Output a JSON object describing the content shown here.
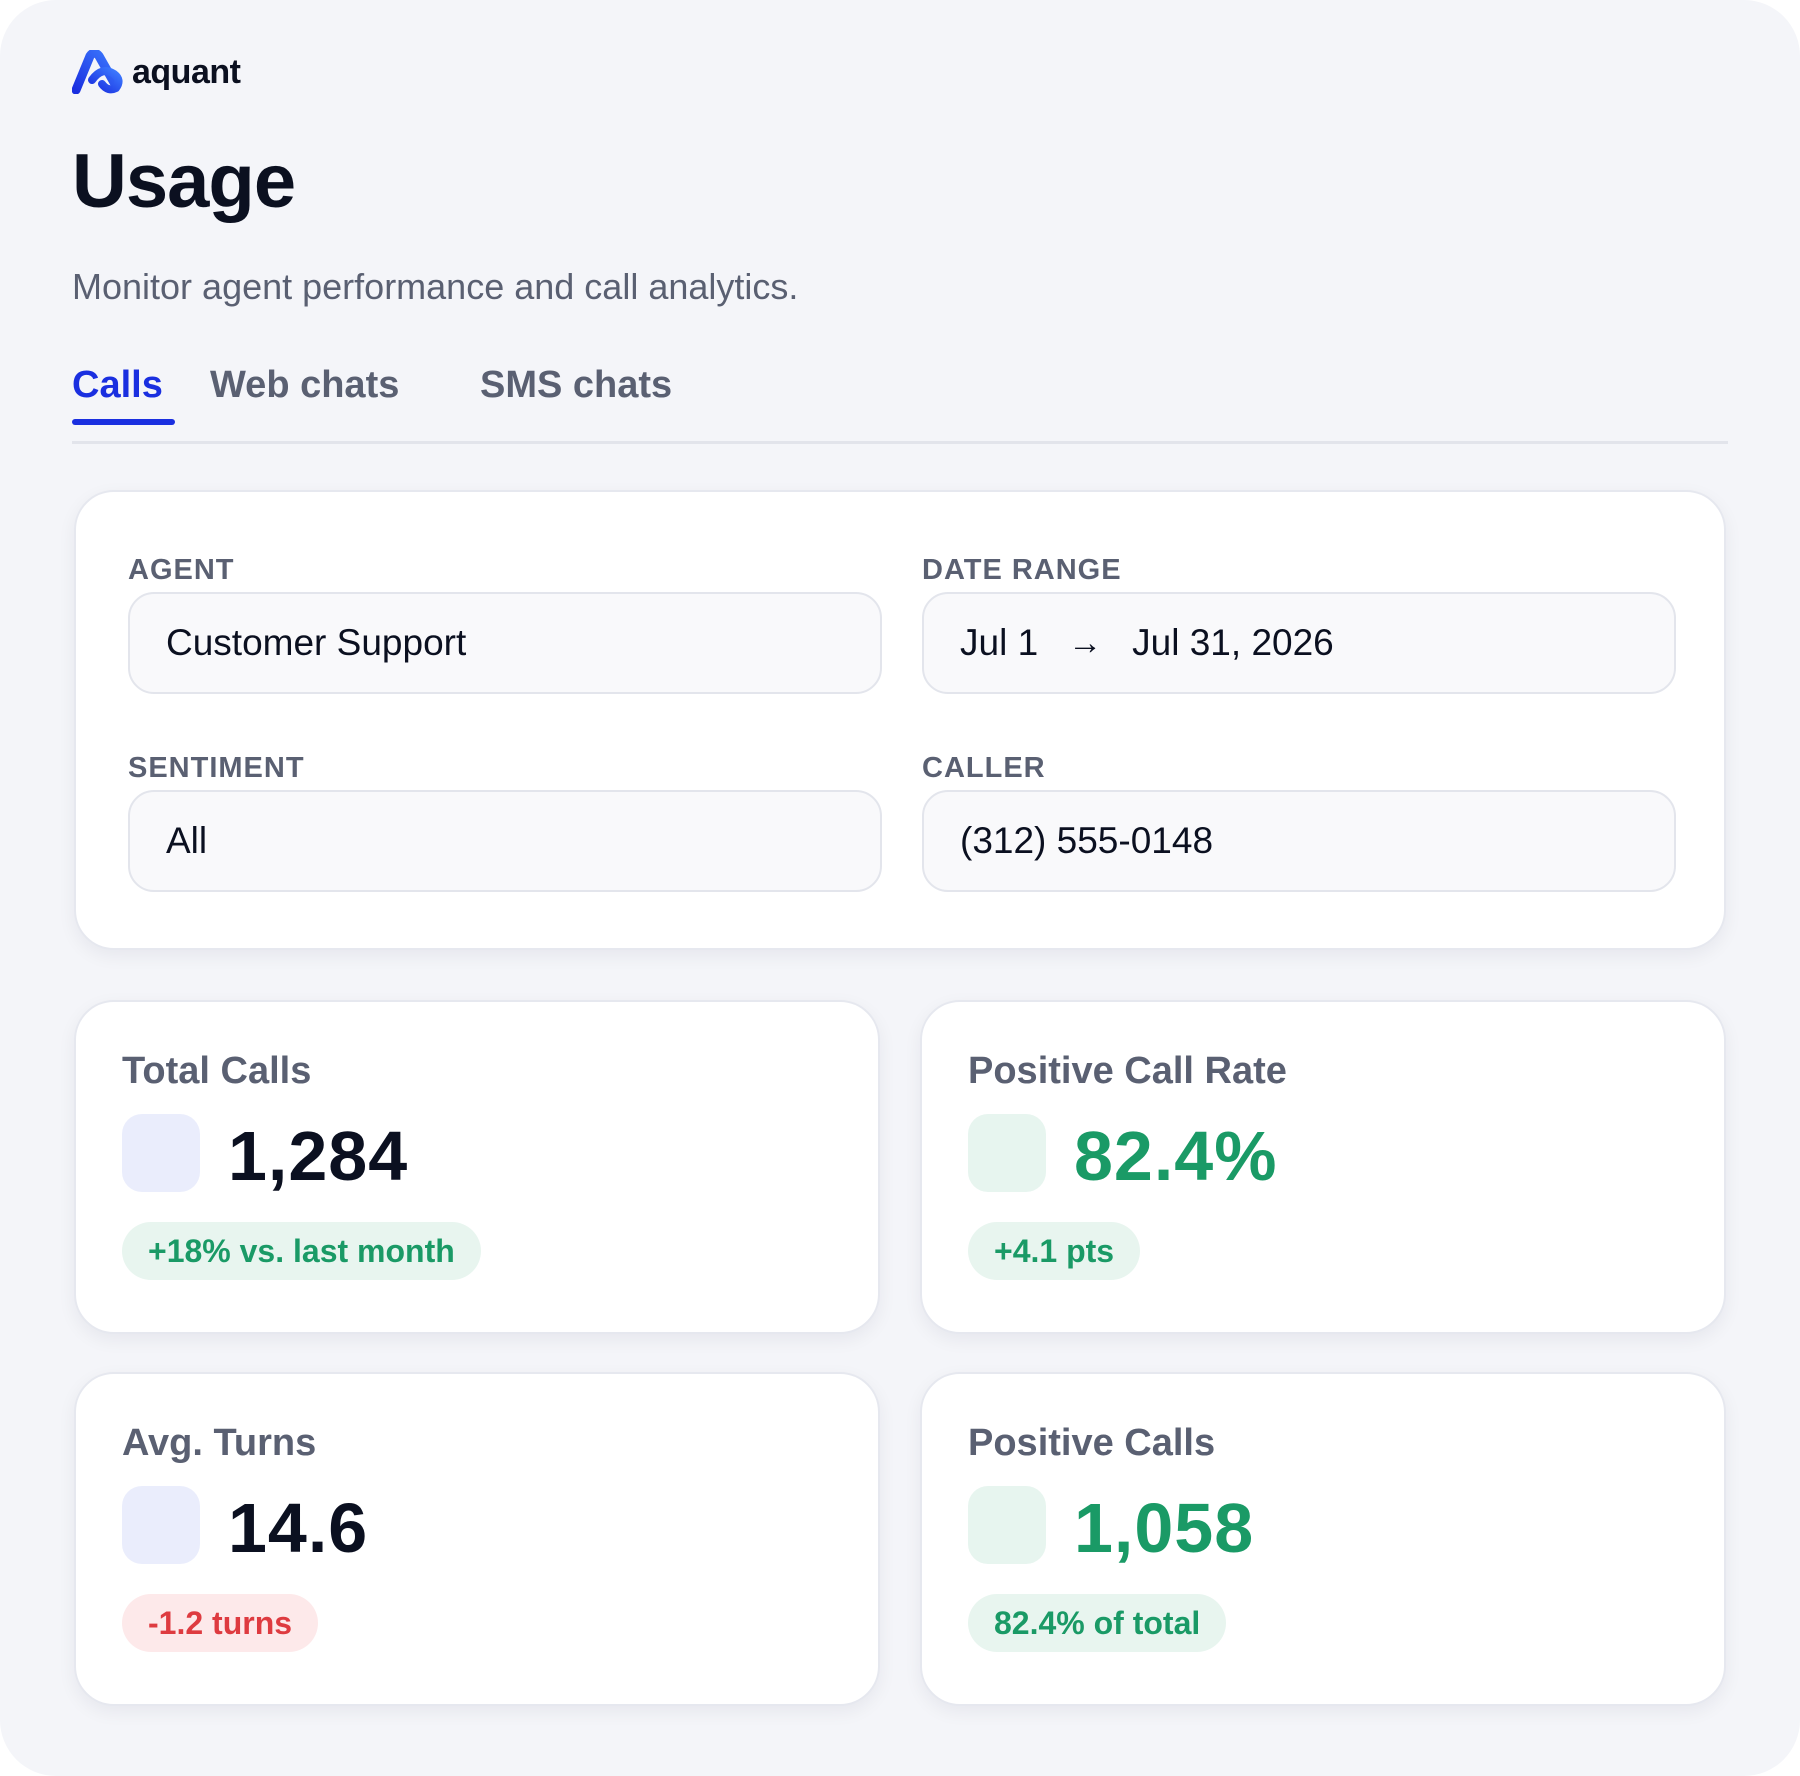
{
  "brand": {
    "logo_text": "aquant",
    "logo_icon": "aquant-logo-icon",
    "accent": "#1a2fe0"
  },
  "header": {
    "title": "Usage",
    "subtitle": "Monitor agent performance and call analytics."
  },
  "tabs": [
    {
      "label": "Calls",
      "active": true
    },
    {
      "label": "Web chats",
      "active": false
    },
    {
      "label": "SMS chats",
      "active": false
    }
  ],
  "filters": {
    "agent": {
      "label": "AGENT",
      "value": "Customer Support"
    },
    "date_range": {
      "label": "DATE RANGE",
      "start": "Jul 1",
      "end": "Jul 31, 2026",
      "arrow_icon": "arrow-right-icon"
    },
    "sentiment": {
      "label": "SENTIMENT",
      "value": "All"
    },
    "caller": {
      "label": "CALLER",
      "value": "(312) 555-0148"
    }
  },
  "stats": [
    {
      "label": "Total Calls",
      "value": "1,284",
      "change": "+18% vs. last month",
      "trend": "up",
      "color": "#0b1020"
    },
    {
      "label": "Positive Call Rate",
      "value": "82.4%",
      "change": "+4.1 pts",
      "trend": "up",
      "color": "#1a9a66"
    },
    {
      "label": "Avg. Turns",
      "value": "14.6",
      "change": "-1.2 turns",
      "trend": "down",
      "color": "#0b1020"
    },
    {
      "label": "Positive Calls",
      "value": "1,058",
      "change": "82.4% of total",
      "trend": "up",
      "color": "#1a9a66"
    }
  ],
  "colors": {
    "positive": "#1a9a66",
    "negative": "#de3b40",
    "text": "#0b1020",
    "muted": "#5a6072"
  }
}
